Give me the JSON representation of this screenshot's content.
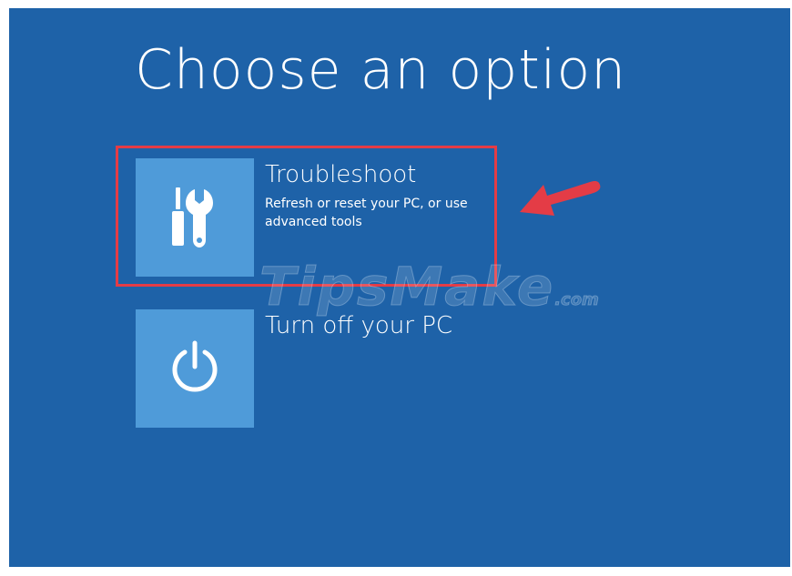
{
  "screen": {
    "title": "Choose an option",
    "background_color": "#1e62a8",
    "tile_color": "#4f9bd9"
  },
  "options": [
    {
      "label": "Troubleshoot",
      "description": "Refresh or reset your PC, or use advanced tools",
      "icon": "tools-icon"
    },
    {
      "label": "Turn off your PC",
      "icon": "power-icon"
    }
  ],
  "annotation": {
    "highlight_color": "#e43c46",
    "arrow": "red-arrow-icon"
  },
  "watermark": {
    "text": "TipsMake",
    "suffix": ".com"
  }
}
